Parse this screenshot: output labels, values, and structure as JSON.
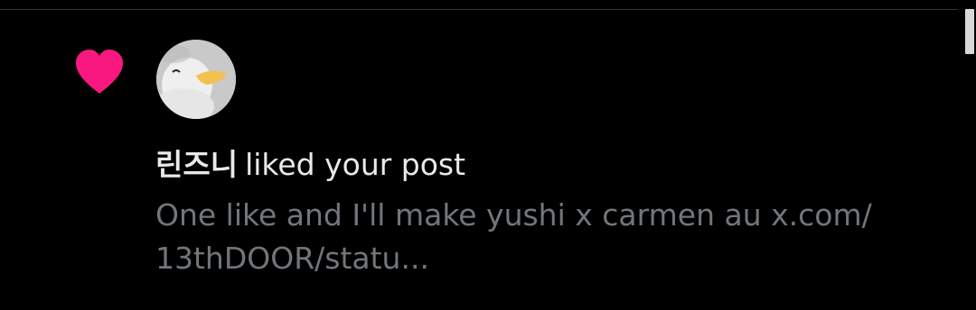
{
  "notification": {
    "type_icon": "heart-icon",
    "icon_color": "#f91880",
    "avatar_icon": "duck-plush-avatar",
    "username": "린즈니",
    "action": "liked your post",
    "post_preview": "One like and I'll make yushi x carmen au x.com/ 13thDOOR/statu..."
  },
  "colors": {
    "background": "#000000",
    "primary_text": "#e7e9ea",
    "secondary_text": "#71767b",
    "divider": "#2f3336"
  }
}
